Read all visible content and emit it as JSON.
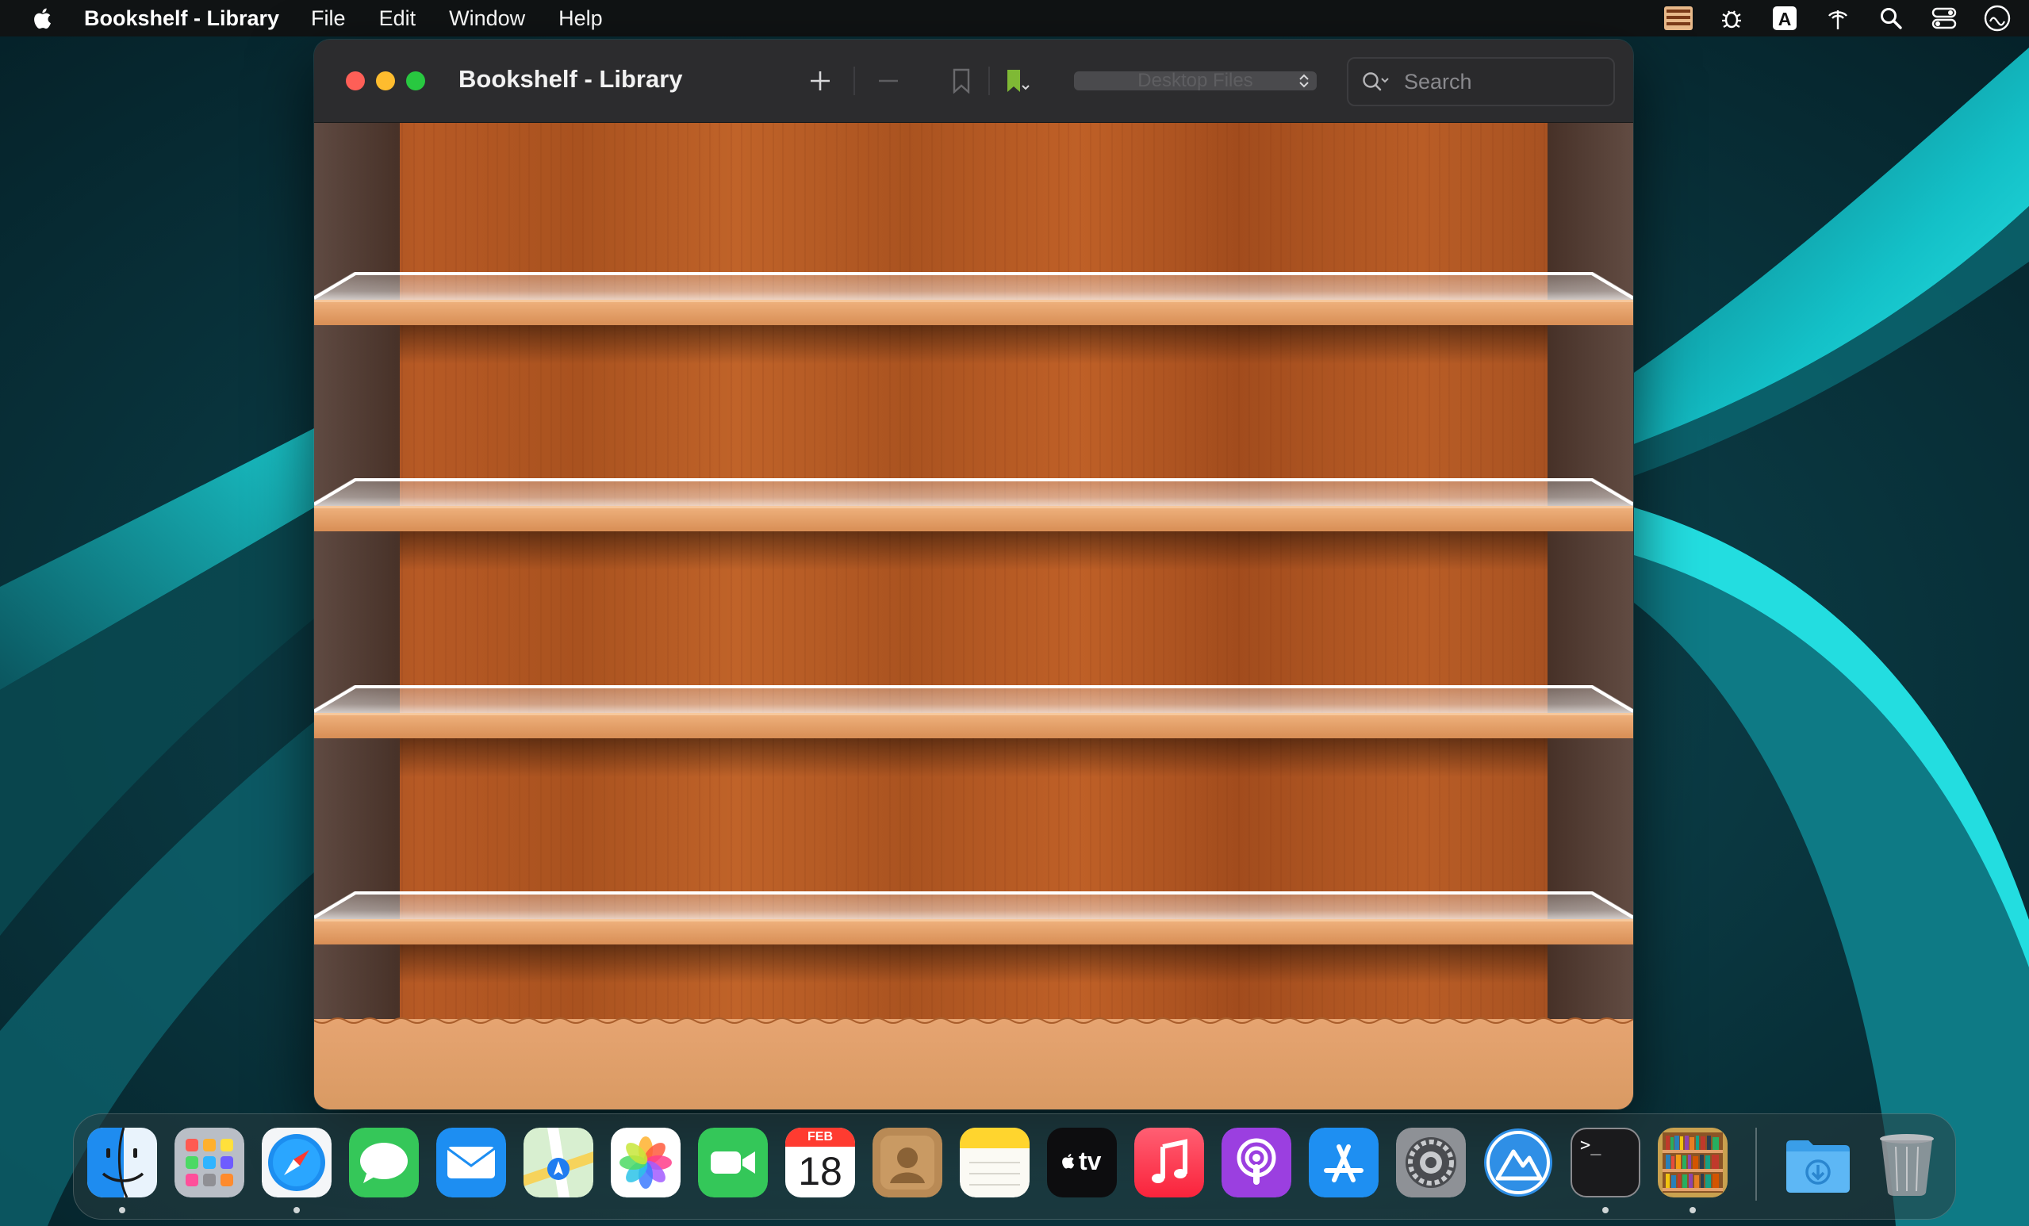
{
  "menubar": {
    "app_name": "Bookshelf - Library",
    "items": [
      "File",
      "Edit",
      "Window",
      "Help"
    ]
  },
  "window": {
    "title": "Bookshelf - Library",
    "toolbar": {
      "add_label": "+",
      "remove_label": "—",
      "collection_popup": "Desktop Files",
      "search_placeholder": "Search"
    }
  },
  "dock": {
    "apps": [
      {
        "name": "Finder",
        "running": true
      },
      {
        "name": "Launchpad",
        "running": false
      },
      {
        "name": "Safari",
        "running": true
      },
      {
        "name": "Messages",
        "running": false
      },
      {
        "name": "Mail",
        "running": false
      },
      {
        "name": "Maps",
        "running": false
      },
      {
        "name": "Photos",
        "running": false
      },
      {
        "name": "FaceTime",
        "running": false
      },
      {
        "name": "Calendar",
        "running": false,
        "month": "FEB",
        "day": "18"
      },
      {
        "name": "Contacts",
        "running": false
      },
      {
        "name": "Notes",
        "running": false
      },
      {
        "name": "TV",
        "running": false,
        "label": "tv"
      },
      {
        "name": "Music",
        "running": false
      },
      {
        "name": "Podcasts",
        "running": false
      },
      {
        "name": "App Store",
        "running": false
      },
      {
        "name": "System Settings",
        "running": false
      },
      {
        "name": "Mountain App",
        "running": false
      },
      {
        "name": "Terminal",
        "running": true,
        "prompt": ">_"
      },
      {
        "name": "Bookshelf",
        "running": true
      },
      {
        "name": "Downloads",
        "running": false
      },
      {
        "name": "Trash",
        "running": false
      }
    ]
  },
  "colors": {
    "wood": "#b55a24",
    "shelf_edge": "#e2a06a",
    "wallpaper_glow": "#19e3e6",
    "close": "#fe5f57",
    "minimize": "#febc2e",
    "maximize": "#28c840"
  }
}
